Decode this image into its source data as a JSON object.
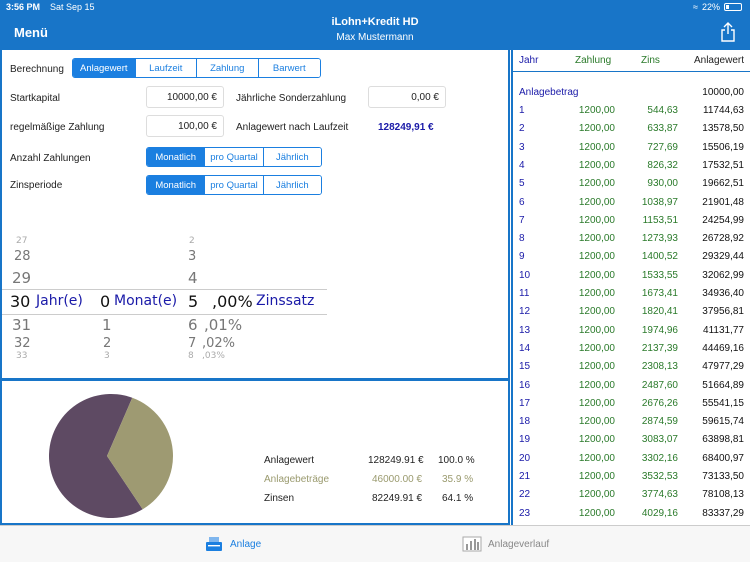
{
  "status": {
    "time": "3:56 PM",
    "date": "Sat Sep 15",
    "battery": "22%"
  },
  "nav": {
    "menu": "Menü",
    "title": "iLohn+Kredit HD",
    "subtitle": "Max Mustermann"
  },
  "form": {
    "berechnung_label": "Berechnung",
    "berechnung_options": [
      "Anlagewert",
      "Laufzeit",
      "Zahlung",
      "Barwert"
    ],
    "startkapital_label": "Startkapital",
    "startkapital_value": "10000,00 €",
    "sonder_label": "Jährliche Sonderzahlung",
    "sonder_value": "0,00 €",
    "zahlung_label": "regelmäßige Zahlung",
    "zahlung_value": "100,00 €",
    "anlagewert_label": "Anlagewert nach Laufzeit",
    "anlagewert_value": "128249,91 €",
    "anzahl_label": "Anzahl Zahlungen",
    "anzahl_options": [
      "Monatlich",
      "pro Quartal",
      "Jährlich"
    ],
    "zinsperiode_label": "Zinsperiode",
    "zinsperiode_options": [
      "Monatlich",
      "pro Quartal",
      "Jährlich"
    ]
  },
  "picker": {
    "years": [
      "27",
      "28",
      "29",
      "30",
      "31",
      "32",
      "33"
    ],
    "year_unit": "Jahr(e)",
    "months": [
      "",
      "",
      "",
      "0",
      "1",
      "2",
      "3"
    ],
    "month_unit": "Monat(e)",
    "rates": [
      "2",
      "3",
      "4",
      "5",
      "6",
      "7",
      "8"
    ],
    "rate_decimals": [
      ",00%",
      ",01%",
      ",02%",
      ",03%"
    ],
    "rate_unit": "Zinssatz"
  },
  "summary": {
    "rows": [
      {
        "label": "Anlagewert",
        "value": "128249.91 €",
        "pct": "100.0 %",
        "color": "#555555"
      },
      {
        "label": "Anlagebeträge",
        "value": "46000.00 €",
        "pct": "35.9 %",
        "color": "#9a9a6e"
      },
      {
        "label": "Zinsen",
        "value": "82249.91 €",
        "pct": "64.1 %",
        "color": "#555555"
      }
    ],
    "pie_share_beitraege": 0.359,
    "pie_colors": {
      "zinsen": "#5e4a63",
      "beitraege": "#9e9a72"
    }
  },
  "table": {
    "headers": [
      "Jahr",
      "Zahlung",
      "Zins",
      "Anlagewert"
    ],
    "start_label": "Anlagebetrag",
    "start_value": "10000,00",
    "rows": [
      [
        "1",
        "1200,00",
        "544,63",
        "11744,63"
      ],
      [
        "2",
        "1200,00",
        "633,87",
        "13578,50"
      ],
      [
        "3",
        "1200,00",
        "727,69",
        "15506,19"
      ],
      [
        "4",
        "1200,00",
        "826,32",
        "17532,51"
      ],
      [
        "5",
        "1200,00",
        "930,00",
        "19662,51"
      ],
      [
        "6",
        "1200,00",
        "1038,97",
        "21901,48"
      ],
      [
        "7",
        "1200,00",
        "1153,51",
        "24254,99"
      ],
      [
        "8",
        "1200,00",
        "1273,93",
        "26728,92"
      ],
      [
        "9",
        "1200,00",
        "1400,52",
        "29329,44"
      ],
      [
        "10",
        "1200,00",
        "1533,55",
        "32062,99"
      ],
      [
        "11",
        "1200,00",
        "1673,41",
        "34936,40"
      ],
      [
        "12",
        "1200,00",
        "1820,41",
        "37956,81"
      ],
      [
        "13",
        "1200,00",
        "1974,96",
        "41131,77"
      ],
      [
        "14",
        "1200,00",
        "2137,39",
        "44469,16"
      ],
      [
        "15",
        "1200,00",
        "2308,13",
        "47977,29"
      ],
      [
        "16",
        "1200,00",
        "2487,60",
        "51664,89"
      ],
      [
        "17",
        "1200,00",
        "2676,26",
        "55541,15"
      ],
      [
        "18",
        "1200,00",
        "2874,59",
        "59615,74"
      ],
      [
        "19",
        "1200,00",
        "3083,07",
        "63898,81"
      ],
      [
        "20",
        "1200,00",
        "3302,16",
        "68400,97"
      ],
      [
        "21",
        "1200,00",
        "3532,53",
        "73133,50"
      ],
      [
        "22",
        "1200,00",
        "3774,63",
        "78108,13"
      ],
      [
        "23",
        "1200,00",
        "4029,16",
        "83337,29"
      ]
    ]
  },
  "tabs": {
    "anlage": "Anlage",
    "verlauf": "Anlageverlauf"
  }
}
